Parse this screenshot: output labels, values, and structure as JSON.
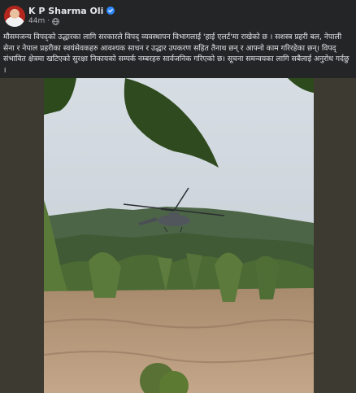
{
  "post": {
    "author": "K P Sharma Oli",
    "time": "44m",
    "privacy_icon": "globe-icon",
    "verified_icon": "verified-badge-icon",
    "caption": "मौसमजन्य विपद्को उद्धारका लागि सरकारले विपद् व्यवस्थापन विभागलाई 'हाई एलर्ट'मा राखेको छ । सशस्त्र प्रहरी बल, नेपाली सेना र नेपाल प्रहरीका स्वयंसेवकहरु आवश्यक साधन र उद्धार उपकरण सहित तैनाथ छन् र आफ्नो काम गरिरहेका छन्। विपद् संभावित क्षेत्रमा खटिएको सुरक्षा निकायको सम्पर्क नम्बरहरु सार्वजनिक गरिएको छ। सूचना समन्वयका लागि सबैलाई अनुरोध गर्दछु ।"
  },
  "colors": {
    "background": "#242526",
    "text": "#e4e6eb",
    "secondary_text": "#b0b3b8",
    "verified": "#2d88ff"
  }
}
